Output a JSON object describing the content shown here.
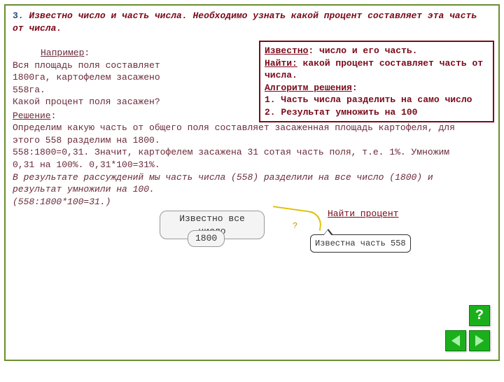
{
  "title": {
    "number": "3.",
    "text": "Известно число и часть числа. Необходимо узнать какой процент составляет эта часть от числа."
  },
  "info_box": {
    "known_label": "Известно",
    "known_text": ": число и его часть.",
    "find_label": "Найти:",
    "find_text": " какой процент составляет часть от числа.",
    "algo_label": "Алгоритм решения",
    "algo_colon": ":",
    "step1": "1. Часть числа разделить на само число",
    "step2": "2. Результат умножить на 100"
  },
  "example": {
    "label": "Например",
    "colon": ":",
    "l1": "Вся площадь поля составляет",
    "l2": "1800га, картофелем засажено",
    "l3": "558га.",
    "l4": "Какой процент поля засажен?"
  },
  "solution": {
    "label": "Решение",
    "suffix": ":",
    "p1": "Определим какую часть от общего поля составляет засаженная площадь картофеля, для этого 558 разделим на 1800.",
    "p2": "558:1800=0,31. Значит, картофелем засажена 31 сотая часть поля, т.е. 1%. Умножим 0,31 на 100%. 0,31*100=31%.",
    "p3": "В результате рассуждений мы часть числа (558) разделили на все число (1800) и результат умножили на 100.",
    "p4": "(558:1800*100=31.)"
  },
  "bottom": {
    "known_all": "Известно все число",
    "value_all": "1800",
    "find_percent": "Найти процент",
    "qmark": "?",
    "known_part": "Известна часть 558"
  },
  "nav": {
    "help": "?"
  }
}
